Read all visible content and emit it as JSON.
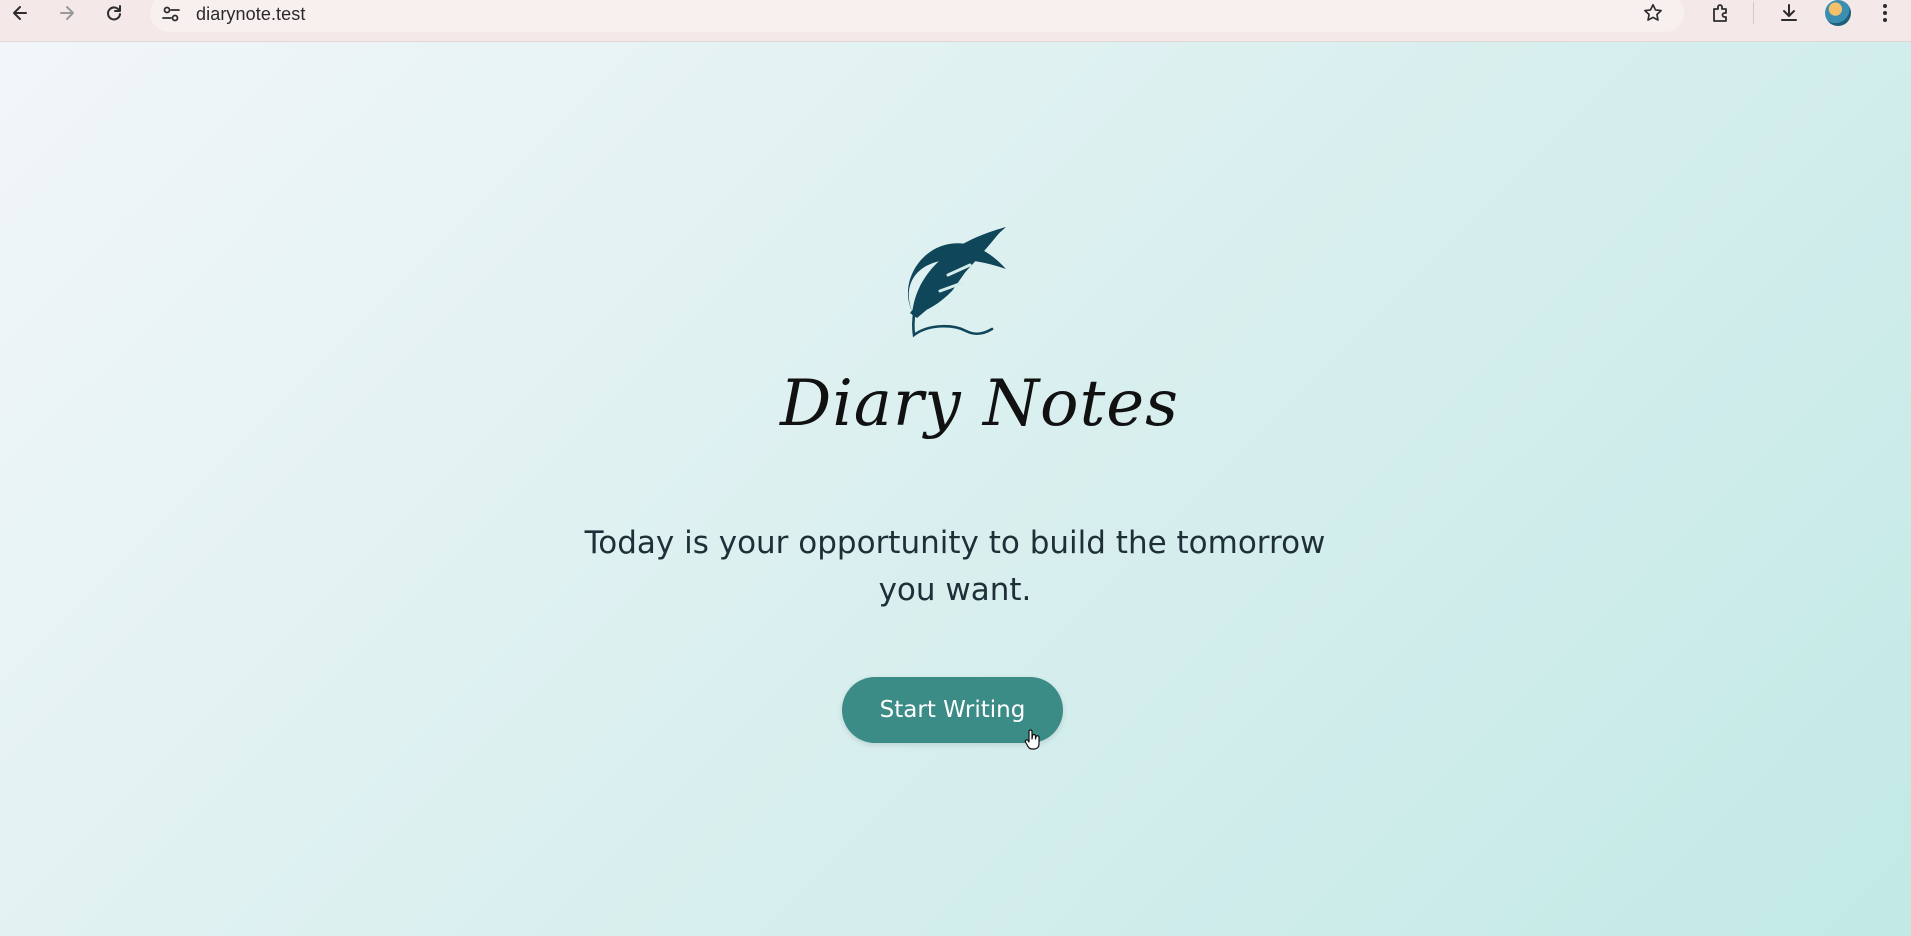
{
  "browser": {
    "url": "diarynote.test",
    "icons": [
      "back-arrow-icon",
      "forward-arrow-icon",
      "reload-icon",
      "site-settings-icon",
      "bookmark-star-icon",
      "extensions-icon",
      "download-icon",
      "profile-avatar",
      "more-menu-icon"
    ]
  },
  "hero": {
    "logo_text": "Diary Notes",
    "tagline": "Today is your opportunity to build the tomorrow you want.",
    "cta_label": "Start Writing"
  },
  "colors": {
    "accent": "#3b8b87",
    "logo_feather": "#0f4659",
    "text_dark": "#1f2f38",
    "background_start": "#f2f6f8",
    "background_end": "#c2e9e6"
  }
}
